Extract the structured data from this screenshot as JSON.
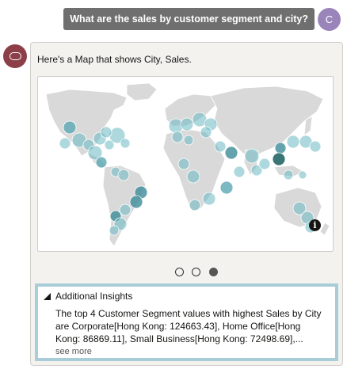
{
  "user": {
    "question": "What are the sales by customer segment and city?",
    "avatar_initial": "C"
  },
  "bot": {
    "avatar_icon": "oracle-ring-icon",
    "intro": "Here's a Map that shows City, Sales."
  },
  "map": {
    "type": "bubble-map",
    "info_icon": "i",
    "bubble_color": "#6ab8c3",
    "land_color": "#d9d9d9"
  },
  "carousel": {
    "pages": 3,
    "active_page": 3
  },
  "insights": {
    "header": "Additional Insights",
    "text": "The top 4 Customer Segment values with highest Sales by City\nare Corporate[Hong Kong: 124663.43], Home Office[Hong\nKong: 86869.11], Small Business[Hong Kong: 72498.69],...",
    "see_more": "see more"
  }
}
